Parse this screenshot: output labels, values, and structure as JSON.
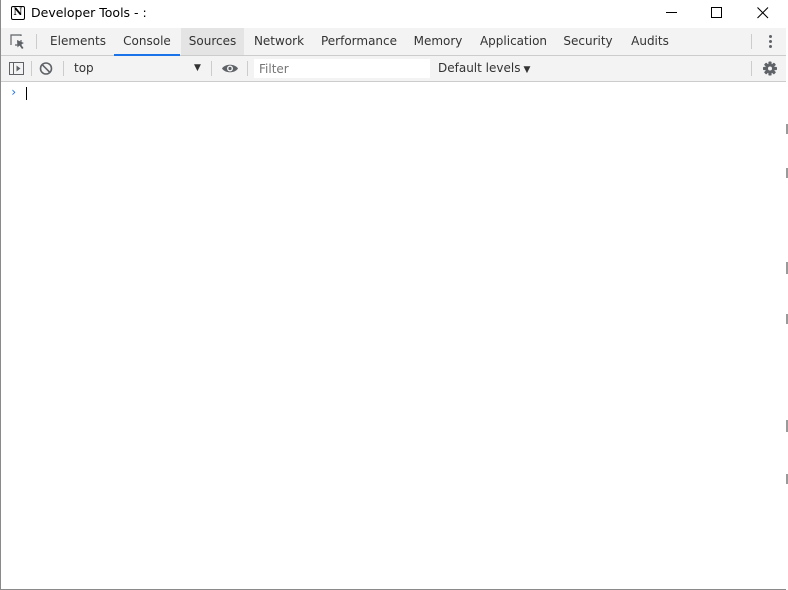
{
  "window": {
    "title": "Developer Tools - :",
    "app_icon_letter": "N"
  },
  "tabs": [
    {
      "label": "Elements"
    },
    {
      "label": "Console"
    },
    {
      "label": "Sources"
    },
    {
      "label": "Network"
    },
    {
      "label": "Performance"
    },
    {
      "label": "Memory"
    },
    {
      "label": "Application"
    },
    {
      "label": "Security"
    },
    {
      "label": "Audits"
    }
  ],
  "active_tab": "Console",
  "hovered_tab": "Sources",
  "toolbar": {
    "context_value": "top",
    "filter_placeholder": "Filter",
    "levels_label": "Default levels"
  },
  "console": {
    "prompt_symbol": "›",
    "input_value": ""
  },
  "colors": {
    "accent": "#1a73e8",
    "toolbar_bg": "#f3f3f3",
    "divider": "#cccccc"
  }
}
